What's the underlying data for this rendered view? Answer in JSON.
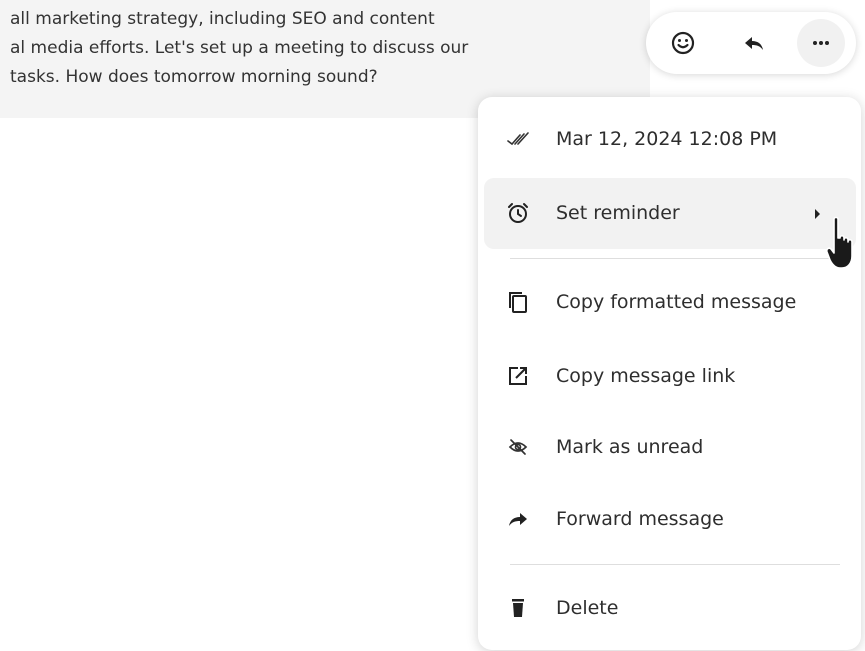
{
  "message": {
    "lines": [
      "all marketing strategy, including SEO and content",
      "al media efforts. Let's set up a meeting to discuss our",
      "tasks. How does tomorrow morning sound?"
    ]
  },
  "toolbar": {
    "buttons": [
      {
        "name": "add-reaction-button",
        "icon": "smile-icon"
      },
      {
        "name": "reply-button",
        "icon": "reply-icon"
      },
      {
        "name": "more-actions-button",
        "icon": "more-horizontal-icon",
        "active": true
      }
    ]
  },
  "menu": {
    "timestamp": {
      "label": "Mar 12, 2024 12:08 PM",
      "icon": "double-check-icon"
    },
    "set_reminder": {
      "label": "Set reminder",
      "icon": "alarm-clock-icon",
      "has_submenu": true,
      "highlighted": true
    },
    "copy_formatted": {
      "label": "Copy formatted message",
      "icon": "copy-icon"
    },
    "copy_link": {
      "label": "Copy message link",
      "icon": "external-link-icon"
    },
    "mark_unread": {
      "label": "Mark as unread",
      "icon": "eye-off-icon"
    },
    "forward": {
      "label": "Forward message",
      "icon": "forward-arrow-icon"
    },
    "delete": {
      "label": "Delete",
      "icon": "trash-icon"
    }
  },
  "colors": {
    "message_background": "#f4f4f4",
    "menu_background": "#ffffff",
    "highlight": "#f2f2f2",
    "text": "#2e2e2e"
  }
}
